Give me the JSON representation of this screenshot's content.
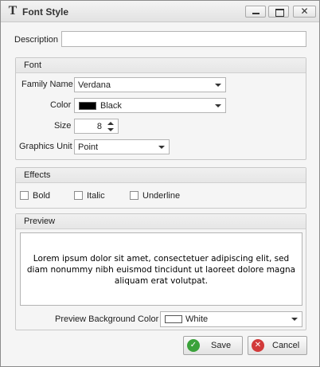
{
  "window": {
    "title": "Font Style",
    "icon": "font-style-icon"
  },
  "titlebar_buttons": {
    "minimize": "minimize-icon",
    "maximize": "maximize-icon",
    "close": "close-icon",
    "close_glyph": "✕"
  },
  "description": {
    "label": "Description",
    "value": ""
  },
  "font_group": {
    "title": "Font",
    "family_label": "Family Name",
    "family_value": "Verdana",
    "color_label": "Color",
    "color_value": "Black",
    "color_swatch": "#000000",
    "size_label": "Size",
    "size_value": "8",
    "unit_label": "Graphics Unit",
    "unit_value": "Point"
  },
  "effects_group": {
    "title": "Effects",
    "bold_label": "Bold",
    "bold_checked": false,
    "italic_label": "Italic",
    "italic_checked": false,
    "underline_label": "Underline",
    "underline_checked": false
  },
  "preview_group": {
    "title": "Preview",
    "text": "Lorem ipsum dolor sit amet, consectetuer adipiscing elit, sed diam nonummy nibh euismod tincidunt ut laoreet dolore magna aliquam erat volutpat.",
    "bg_label": "Preview Background Color",
    "bg_value": "White",
    "bg_swatch": "#ffffff"
  },
  "buttons": {
    "save_label": "Save",
    "cancel_label": "Cancel",
    "save_color": "#3aa23a",
    "cancel_color": "#d23a3a"
  }
}
